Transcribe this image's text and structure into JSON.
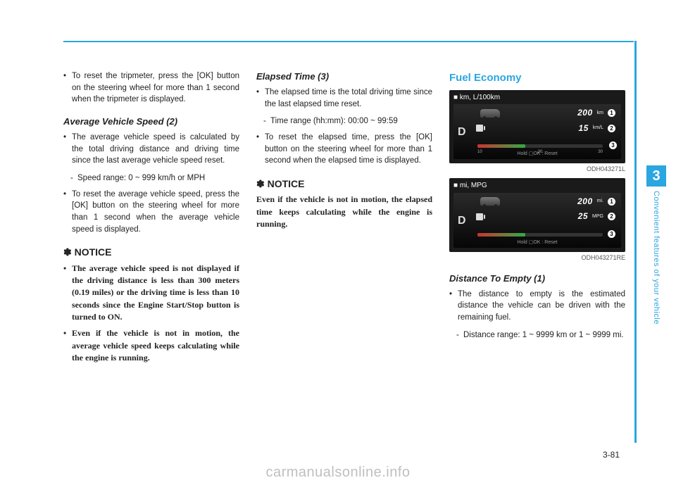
{
  "side": {
    "chapter_num": "3",
    "tab_text": "Convenient features of your vehicle"
  },
  "col1": {
    "reset_tripmeter": "To reset the tripmeter, press the [OK] button on the steering wheel for more than 1 second when the tripmeter is displayed.",
    "avg_speed_head": "Average Vehicle Speed (2)",
    "avg_speed_bullet1": "The average vehicle speed is calculated by the total driving distance and driving time since the last average vehicle speed reset.",
    "avg_speed_range": "Speed range: 0 ~ 999 km/h or MPH",
    "avg_speed_bullet2": "To reset the average vehicle speed, press the [OK] button on the steering wheel for more than 1 second when the average vehicle speed is displayed.",
    "notice_head": "✽ NOTICE",
    "notice_b1": "The average vehicle speed is not displayed if the driving distance is less than 300 meters (0.19 miles) or the driving time is less than 10 seconds since the Engine Start/Stop button is turned to ON.",
    "notice_b2": "Even if the vehicle is not in motion, the average vehicle speed keeps calculating while the engine is running."
  },
  "col2": {
    "elapsed_head": "Elapsed Time (3)",
    "elapsed_b1": "The elapsed time is the total driving time since the last elapsed time reset.",
    "elapsed_range": "Time range (hh:mm): 00:00 ~ 99:59",
    "elapsed_b2": "To reset the elapsed time,  press the [OK] button on the steering wheel for more than 1 second when the elapsed time is displayed.",
    "notice_head": "✽ NOTICE",
    "notice_text": "Even if the vehicle is not in motion, the elapsed time keeps calculating while the engine is running."
  },
  "col3": {
    "fuel_head": "Fuel Economy",
    "img1": {
      "label": "■ km, L/100km",
      "gear": "D",
      "range_val": "200",
      "range_unit": "km",
      "econ_val": "15",
      "econ_unit": "km/L",
      "ticks": [
        "10",
        "20",
        "30"
      ],
      "marker1": "1",
      "marker2": "2",
      "marker3": "3",
      "reset": "Hold ▢OK : Reset",
      "code": "ODH043271L"
    },
    "img2": {
      "label": "■ mi, MPG",
      "gear": "D",
      "range_val": "200",
      "range_unit": "mi.",
      "econ_val": "25",
      "econ_unit": "MPG",
      "marker1": "1",
      "marker2": "2",
      "marker3": "3",
      "reset": "Hold ▢OK : Reset",
      "code": "ODH043271RE"
    },
    "dte_head": "Distance To Empty (1)",
    "dte_b1": "The distance to empty is the estimated distance the vehicle can be driven with the remaining fuel.",
    "dte_range": "Distance range: 1 ~ 9999 km or 1 ~ 9999 mi."
  },
  "page_num": "3-81",
  "watermark": "carmanualsonline.info"
}
